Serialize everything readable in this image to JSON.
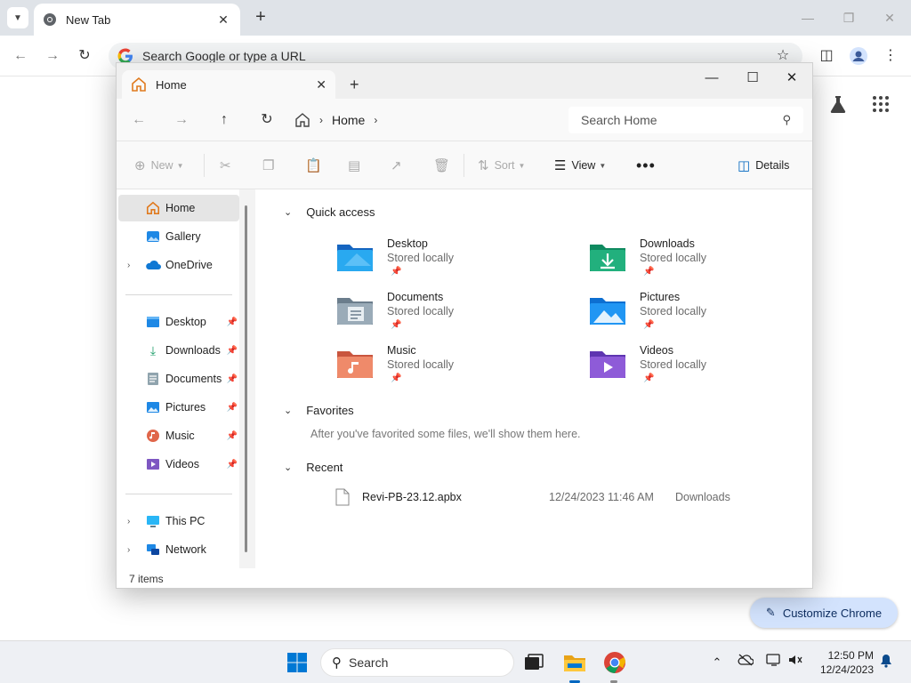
{
  "chrome": {
    "tab_title": "New Tab",
    "omnibox_placeholder": "Search Google or type a URL",
    "customize_label": "Customize Chrome"
  },
  "explorer": {
    "tab_title": "Home",
    "breadcrumb": "Home",
    "search_placeholder": "Search Home",
    "commands": {
      "new": "New",
      "sort": "Sort",
      "view": "View",
      "details": "Details"
    },
    "sidebar": {
      "top": [
        {
          "label": "Home",
          "active": true
        },
        {
          "label": "Gallery"
        },
        {
          "label": "OneDrive"
        }
      ],
      "pinned": [
        {
          "label": "Desktop"
        },
        {
          "label": "Downloads"
        },
        {
          "label": "Documents"
        },
        {
          "label": "Pictures"
        },
        {
          "label": "Music"
        },
        {
          "label": "Videos"
        }
      ],
      "bottom": [
        {
          "label": "This PC"
        },
        {
          "label": "Network"
        }
      ]
    },
    "status": "7 items",
    "sections": {
      "quick_access": "Quick access",
      "favorites": "Favorites",
      "favorites_empty": "After you've favorited some files, we'll show them here.",
      "recent": "Recent"
    },
    "quick_access": [
      {
        "name": "Desktop",
        "sub": "Stored locally"
      },
      {
        "name": "Downloads",
        "sub": "Stored locally"
      },
      {
        "name": "Documents",
        "sub": "Stored locally"
      },
      {
        "name": "Pictures",
        "sub": "Stored locally"
      },
      {
        "name": "Music",
        "sub": "Stored locally"
      },
      {
        "name": "Videos",
        "sub": "Stored locally"
      }
    ],
    "recent": [
      {
        "name": "Revi-PB-23.12.apbx",
        "date": "12/24/2023 11:46 AM",
        "location": "Downloads"
      }
    ]
  },
  "taskbar": {
    "search_placeholder": "Search",
    "time": "12:50 PM",
    "date": "12/24/2023"
  },
  "colors": {
    "accent": "#0067c0",
    "taskbar_bg": "#eef0f4",
    "customize_bg": "#d3e3fd"
  }
}
